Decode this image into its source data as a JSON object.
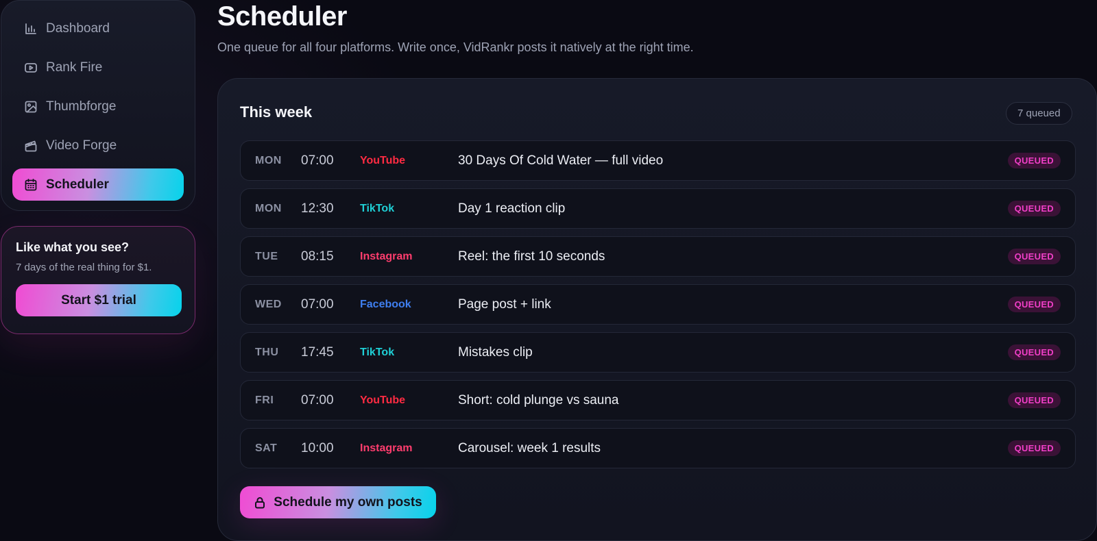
{
  "sidebar": {
    "items": [
      {
        "label": "Dashboard",
        "icon": "bar-chart-icon",
        "active": false
      },
      {
        "label": "Rank Fire",
        "icon": "play-icon",
        "active": false
      },
      {
        "label": "Thumbforge",
        "icon": "image-icon",
        "active": false
      },
      {
        "label": "Video Forge",
        "icon": "clapperboard-icon",
        "active": false
      },
      {
        "label": "Scheduler",
        "icon": "calendar-icon",
        "active": true
      }
    ]
  },
  "trial": {
    "title": "Like what you see?",
    "subtitle": "7 days of the real thing for $1.",
    "button_label": "Start $1 trial"
  },
  "header": {
    "title": "Scheduler",
    "subtitle": "One queue for all four platforms. Write once, VidRankr posts it natively at the right time."
  },
  "panel": {
    "title": "This week",
    "count_label": "7 queued",
    "rows": [
      {
        "day": "MON",
        "time": "07:00",
        "platform": "YouTube",
        "title": "30 Days Of Cold Water — full video",
        "status": "QUEUED"
      },
      {
        "day": "MON",
        "time": "12:30",
        "platform": "TikTok",
        "title": "Day 1 reaction clip",
        "status": "QUEUED"
      },
      {
        "day": "TUE",
        "time": "08:15",
        "platform": "Instagram",
        "title": "Reel: the first 10 seconds",
        "status": "QUEUED"
      },
      {
        "day": "WED",
        "time": "07:00",
        "platform": "Facebook",
        "title": "Page post + link",
        "status": "QUEUED"
      },
      {
        "day": "THU",
        "time": "17:45",
        "platform": "TikTok",
        "title": "Mistakes clip",
        "status": "QUEUED"
      },
      {
        "day": "FRI",
        "time": "07:00",
        "platform": "YouTube",
        "title": "Short: cold plunge vs sauna",
        "status": "QUEUED"
      },
      {
        "day": "SAT",
        "time": "10:00",
        "platform": "Instagram",
        "title": "Carousel: week 1 results",
        "status": "QUEUED"
      }
    ],
    "schedule_button_label": "Schedule my own posts"
  },
  "colors": {
    "youtube": "#ff2b42",
    "tiktok": "#1fd0d6",
    "instagram": "#ff3d6e",
    "facebook": "#3f7ff0",
    "status_text": "#f13fc8",
    "accent_gradient_start": "#f04bd3",
    "accent_gradient_end": "#06d3eb"
  }
}
